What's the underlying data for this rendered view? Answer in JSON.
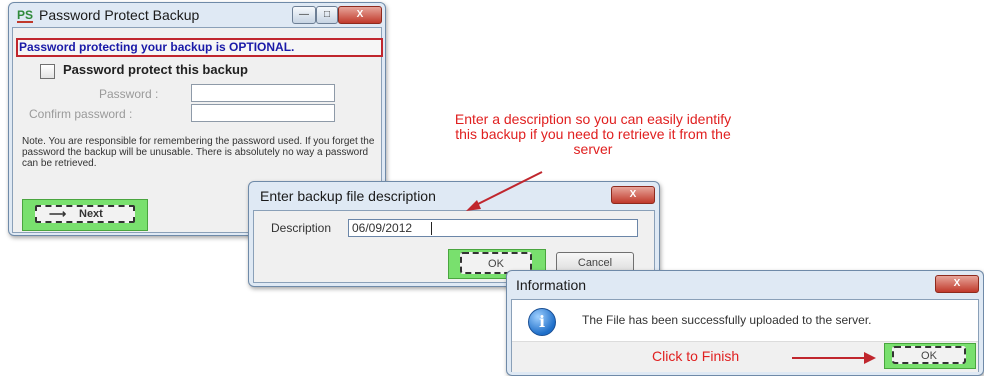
{
  "colors": {
    "accent_red": "#e02020",
    "highlight_green": "#79e06e",
    "optional_text_blue": "#1a1aa8"
  },
  "protect_window": {
    "logo": "PS",
    "title": "Password Protect Backup",
    "optional_notice": "Password protecting your backup is OPTIONAL.",
    "checkbox_label": "Password protect this backup",
    "password_label": "Password :",
    "confirm_label": "Confirm password :",
    "note": "Note. You are responsible for remembering the password used. If you forget the password the backup will be unusable. There is absolutely no way a password can be retrieved.",
    "next_label": "Next"
  },
  "description_dialog": {
    "title": "Enter backup file description",
    "description_label": "Description",
    "description_value": "06/09/2012",
    "ok_label": "OK",
    "cancel_label": "Cancel"
  },
  "info_dialog": {
    "title": "Information",
    "message": "The File has been successfully uploaded to the server.",
    "ok_label": "OK"
  },
  "annotations": {
    "description_hint": "Enter a description so you can easily identify this backup if you need to retrieve it from the server",
    "finish_hint": "Click to Finish"
  }
}
